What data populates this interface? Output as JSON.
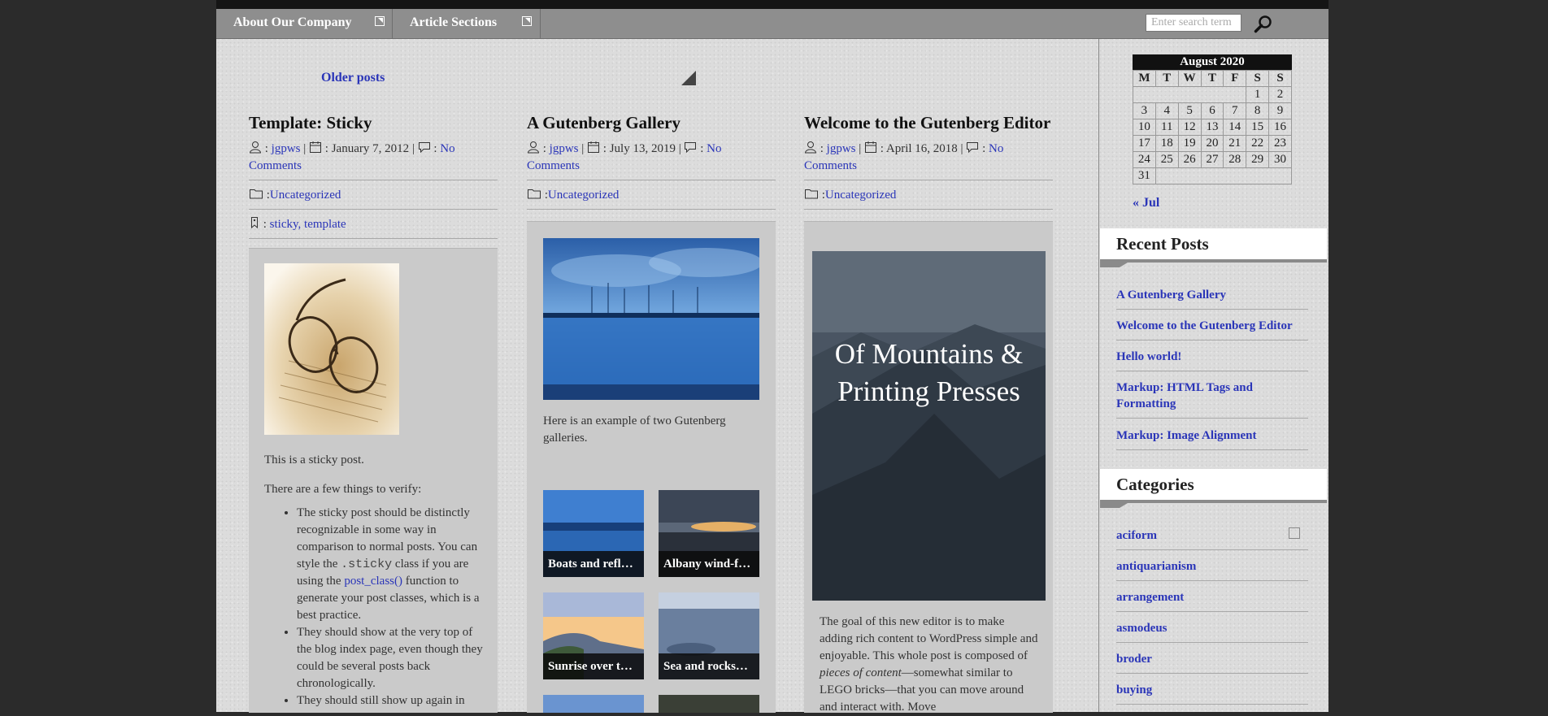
{
  "nav": {
    "items": [
      "About Our Company",
      "Article Sections"
    ],
    "search_placeholder": "Enter search term"
  },
  "older_posts": "Older posts",
  "posts": [
    {
      "title": "Template: Sticky",
      "author": "jgpws",
      "date": "January 7, 2012",
      "comments": "No Comments",
      "category": "Uncategorized",
      "tags": "sticky, template",
      "intro1": "This is a sticky post.",
      "intro2": "There are a few things to verify:",
      "bullet1_a": "The sticky post should be distinctly recognizable in some way in comparison to normal posts. You can style the ",
      "bullet1_code": ".sticky",
      "bullet1_b": " class if you are using the ",
      "bullet1_link": "post_class()",
      "bullet1_c": " function to generate your post classes, which is a best practice.",
      "bullet2": "They should show at the very top of the blog index page, even though they could be several posts back chronologically.",
      "bullet3": "They should still show up again in"
    },
    {
      "title": "A Gutenberg Gallery",
      "author": "jgpws",
      "date": "July 13, 2019",
      "comments": "No Comments",
      "category": "Uncategorized",
      "intro": "Here is an example of two Gutenberg galleries.",
      "captions": [
        "Boats and refl…",
        "Albany wind-f…",
        "Sunrise over t…",
        "Sea and rocks…"
      ]
    },
    {
      "title": "Welcome to the Gutenberg Editor",
      "author": "jgpws",
      "date": "April 16, 2018",
      "comments": "No Comments",
      "category": "Uncategorized",
      "cover_title": "Of Mountains & Printing Presses",
      "text_a": "The goal of this new editor is to make adding rich content to WordPress simple and enjoyable. This whole post is composed of ",
      "text_em": "pieces of content",
      "text_b": "—somewhat similar to LEGO bricks—that you can move around and interact with. Move"
    }
  ],
  "calendar": {
    "caption": "August 2020",
    "days": [
      "M",
      "T",
      "W",
      "T",
      "F",
      "S",
      "S"
    ],
    "rows": [
      [
        "",
        "",
        "",
        "",
        "",
        "1",
        "2"
      ],
      [
        "3",
        "4",
        "5",
        "6",
        "7",
        "8",
        "9"
      ],
      [
        "10",
        "11",
        "12",
        "13",
        "14",
        "15",
        "16"
      ],
      [
        "17",
        "18",
        "19",
        "20",
        "21",
        "22",
        "23"
      ],
      [
        "24",
        "25",
        "26",
        "27",
        "28",
        "29",
        "30"
      ],
      [
        "31",
        "",
        "",
        "",
        "",
        "",
        ""
      ]
    ],
    "prev": "« Jul"
  },
  "recent_posts": {
    "title": "Recent Posts",
    "items": [
      "A Gutenberg Gallery",
      "Welcome to the Gutenberg Editor",
      "Hello world!",
      "Markup: HTML Tags and Formatting",
      "Markup: Image Alignment"
    ]
  },
  "categories": {
    "title": "Categories",
    "items": [
      "aciform",
      "antiquarianism",
      "arrangement",
      "asmodeus",
      "broder",
      "buying"
    ]
  }
}
